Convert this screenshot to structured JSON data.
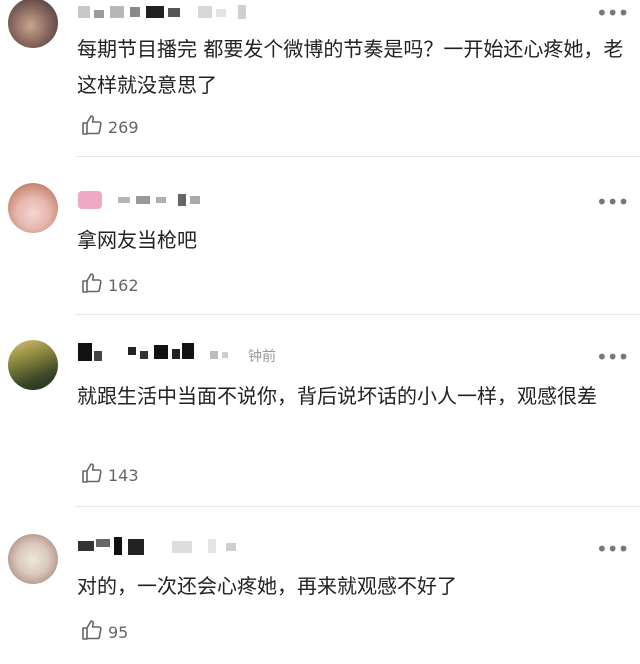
{
  "comments": [
    {
      "text": "每期节目播完 都要发个微博的节奏是吗？一开始还心疼她，老这样就没意思了",
      "likes": "269"
    },
    {
      "text": "拿网友当枪吧",
      "likes": "162"
    },
    {
      "time": "钟前",
      "text": "就跟生活中当面不说你，背后说坏话的小人一样，观感很差",
      "likes": "143"
    },
    {
      "text": "对的，一次还会心疼她，再来就观感不好了",
      "likes": "95"
    }
  ],
  "icons": {
    "more": "more-options-icon",
    "like": "thumbs-up-icon"
  },
  "colors": {
    "text": "#222222",
    "meta": "#9a9a9a",
    "divider": "#e6e6e6"
  }
}
